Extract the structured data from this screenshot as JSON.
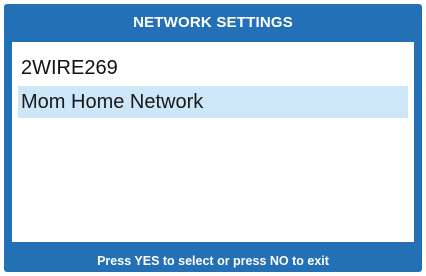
{
  "screen": {
    "title": "NETWORK SETTINGS",
    "networks": [
      {
        "label": "2WIRE269",
        "selected": false
      },
      {
        "label": "Mom Home Network",
        "selected": true
      }
    ],
    "footer_hint": "Press YES to select or press NO to exit"
  },
  "colors": {
    "frame": "#2470b6",
    "list_background": "#ffffff",
    "selection_highlight": "#cde6f8",
    "title_text": "#ffffff"
  }
}
